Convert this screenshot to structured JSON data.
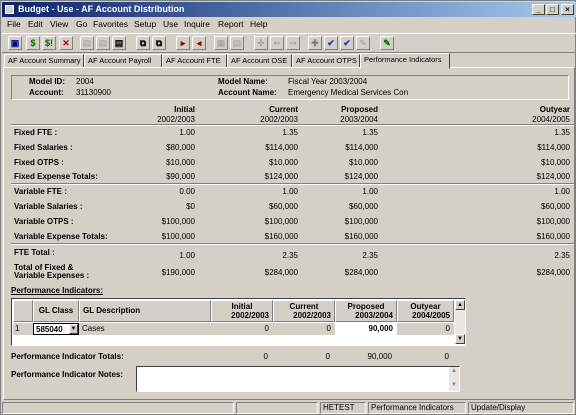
{
  "window": {
    "title": "Budget - Use - AF Account Distribution",
    "controls": {
      "minimize": "_",
      "maximize": "□",
      "close": "×"
    }
  },
  "menu": [
    "File",
    "Edit",
    "View",
    "Go",
    "Favorites",
    "Setup",
    "Use",
    "Inquire",
    "Report",
    "Help"
  ],
  "toolbar": {
    "icons": [
      "save-icon",
      "dollar-icon",
      "dollar-exclaim-icon",
      "delete-icon",
      "grid-icon",
      "grid-icon",
      "grid-icon",
      "copy-icon",
      "copy-icon",
      "nav-icon",
      "nav-icon",
      "edit-icon",
      "list-icon",
      "crosshair-icon",
      "back-arrow-icon",
      "forward-arrow-icon",
      "add-icon",
      "check-icon",
      "check-icon",
      "pencil-icon",
      "marker-icon"
    ],
    "glyphs": [
      "▣",
      "$",
      "$!",
      "✕",
      "▤",
      "▤",
      "▤",
      "⧉",
      "⧉",
      "▸",
      "◂",
      "▦",
      "▤",
      "✜",
      "⇐",
      "⇒",
      "✚",
      "✔",
      "✔",
      "✎",
      "✎"
    ]
  },
  "tabs": [
    "AF Account Summary",
    "AF Account Payroll",
    "AF Account FTE",
    "AF Account OSE",
    "AF Account OTPS",
    "Performance Indicators"
  ],
  "active_tab": "Performance Indicators",
  "header": {
    "model_id_label": "Model ID:",
    "model_id": "2004",
    "account_label": "Account:",
    "account": "31130900",
    "model_name_label": "Model Name:",
    "model_name": "Fiscal Year 2003/2004",
    "account_name_label": "Account Name:",
    "account_name": "Emergency Medical Services Con"
  },
  "columns": [
    {
      "label": "Initial",
      "year": "2002/2003"
    },
    {
      "label": "Current",
      "year": "2002/2003"
    },
    {
      "label": "Proposed",
      "year": "2003/2004"
    },
    {
      "label": "Outyear",
      "year": "2004/2005"
    }
  ],
  "fixed_rows": [
    {
      "label": "Fixed FTE :",
      "values": [
        "1.00",
        "1.35",
        "1.35",
        "1.35"
      ]
    },
    {
      "label": "Fixed Salaries :",
      "values": [
        "$80,000",
        "$114,000",
        "$114,000",
        "$114,000"
      ]
    },
    {
      "label": "Fixed OTPS :",
      "values": [
        "$10,000",
        "$10,000",
        "$10,000",
        "$10,000"
      ]
    },
    {
      "label": "Fixed Expense Totals:",
      "values": [
        "$90,000",
        "$124,000",
        "$124,000",
        "$124,000"
      ]
    }
  ],
  "variable_rows": [
    {
      "label": "Variable FTE :",
      "values": [
        "0.00",
        "1.00",
        "1.00",
        "1.00"
      ]
    },
    {
      "label": "Variable Salaries :",
      "values": [
        "$0",
        "$60,000",
        "$60,000",
        "$60,000"
      ]
    },
    {
      "label": "Variable OTPS :",
      "values": [
        "$100,000",
        "$100,000",
        "$100,000",
        "$100,000"
      ]
    },
    {
      "label": "Variable Expense Totals:",
      "values": [
        "$100,000",
        "$160,000",
        "$160,000",
        "$160,000"
      ]
    }
  ],
  "fte_total": {
    "label": "FTE Total :",
    "values": [
      "1.00",
      "2.35",
      "2.35",
      "2.35"
    ]
  },
  "grand_total": {
    "label_line1": "Total of Fixed &",
    "label_line2": "Variable Expenses :",
    "values": [
      "$190,000",
      "$284,000",
      "$284,000",
      "$284,000"
    ]
  },
  "performance": {
    "section_label": "Performance Indicators:",
    "grid_headers": {
      "gl_class": "GL Class",
      "gl_desc": "GL Description",
      "initial": "Initial",
      "initial_year": "2002/2003",
      "current": "Current",
      "current_year": "2002/2003",
      "proposed": "Proposed",
      "proposed_year": "2003/2004",
      "outyear": "Outyear",
      "outyear_year": "2004/2005"
    },
    "rows": [
      {
        "num": "1",
        "gl_class": "585040",
        "desc": "Cases",
        "initial": "0",
        "current": "0",
        "proposed": "90,000",
        "outyear": "0"
      }
    ],
    "totals_label": "Performance Indicator Totals:",
    "totals": [
      "0",
      "0",
      "90,000",
      "0"
    ],
    "notes_label": "Performance Indicator Notes:",
    "notes_value": ""
  },
  "statusbar": [
    "",
    "",
    "HETEST",
    "Performance Indicators",
    "Update/Display"
  ]
}
